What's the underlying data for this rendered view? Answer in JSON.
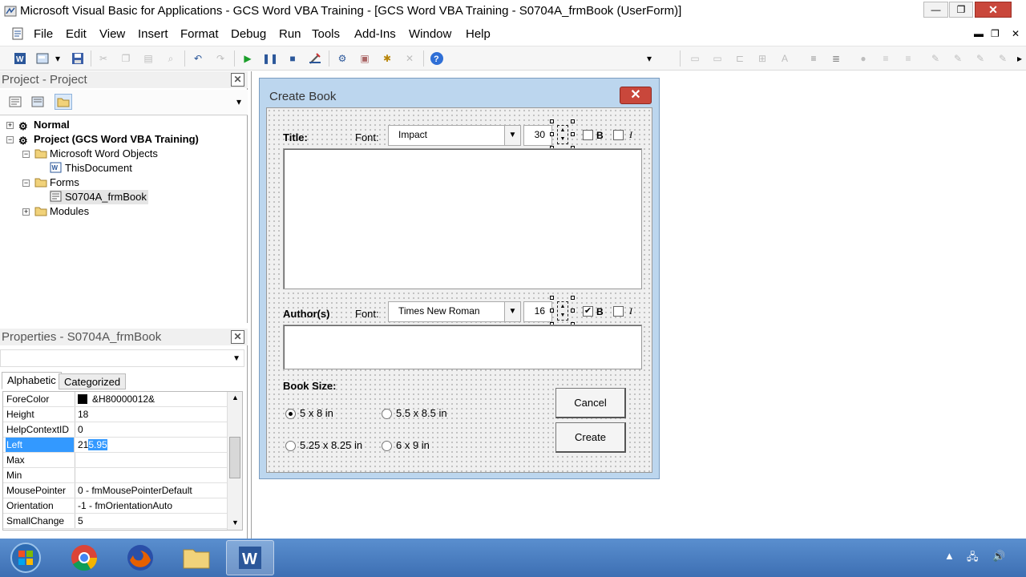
{
  "window": {
    "title": "Microsoft Visual Basic for Applications - GCS Word VBA Training - [GCS Word VBA Training - S0704A_frmBook (UserForm)]",
    "min_glyph": "—",
    "max_glyph": "❐",
    "close_glyph": "✕"
  },
  "menu": {
    "items": [
      "File",
      "Edit",
      "View",
      "Insert",
      "Format",
      "Debug",
      "Run",
      "Tools",
      "Add-Ins",
      "Window",
      "Help"
    ],
    "mdi_min": "▬",
    "mdi_restore": "❐",
    "mdi_close": "✕"
  },
  "project": {
    "title": "Project - Project",
    "close_glyph": "✕",
    "tree": {
      "normal": "Normal",
      "project": "Project (GCS Word VBA Training)",
      "word_objects": "Microsoft Word Objects",
      "this_document": "ThisDocument",
      "forms": "Forms",
      "form_item": "S0704A_frmBook",
      "modules": "Modules"
    }
  },
  "properties": {
    "title": "Properties - S0704A_frmBook",
    "close_glyph": "✕",
    "tab_alphabetic": "Alphabetic",
    "tab_categorized": "Categorized",
    "rows": [
      {
        "name": "ForeColor",
        "value": "&H80000012&"
      },
      {
        "name": "Height",
        "value": "18"
      },
      {
        "name": "HelpContextID",
        "value": "0"
      },
      {
        "name": "Left",
        "value_plain": "21",
        "value_selected": "5.95"
      },
      {
        "name": "Max",
        "value": ""
      },
      {
        "name": "Min",
        "value": ""
      },
      {
        "name": "MousePointer",
        "value": "0 - fmMousePointerDefault"
      },
      {
        "name": "Orientation",
        "value": "-1 - fmOrientationAuto"
      },
      {
        "name": "SmallChange",
        "value": "5"
      }
    ]
  },
  "userform": {
    "caption": "Create Book",
    "close_glyph": "✕",
    "title_label": "Title:",
    "font_label": "Font:",
    "title_font": "Impact",
    "title_size": "30",
    "bold_label": "B",
    "italic_label": "I",
    "author_label": "Author(s)",
    "author_font": "Times New Roman",
    "author_size": "16",
    "author_bold_checked": "✔",
    "book_size_label": "Book Size:",
    "sizes": [
      "5 x 8 in",
      "5.5 x 8.5 in",
      "5.25 x 8.25 in",
      "6 x 9 in"
    ],
    "selected_size": "5 x 8 in",
    "cancel_label": "Cancel",
    "create_label": "Create"
  },
  "colors": {
    "form_titlebar": "#bcd6ee",
    "selection": "#3399ff",
    "close_red": "#c9473b",
    "taskbar": "#4a7fc1"
  }
}
